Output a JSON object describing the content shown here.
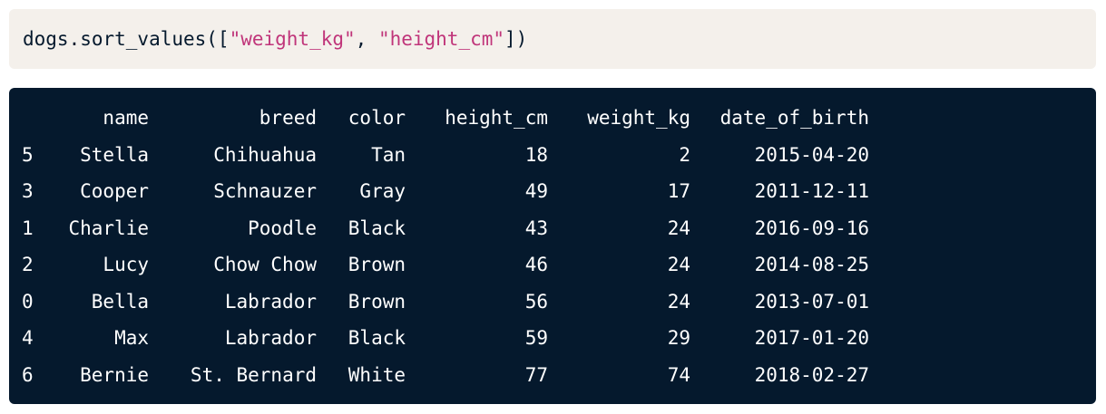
{
  "code": {
    "prefix": "dogs.sort_values([",
    "arg1": "\"weight_kg\"",
    "sep": ", ",
    "arg2": "\"height_cm\"",
    "suffix": "])"
  },
  "table": {
    "columns": [
      "",
      "name",
      "breed",
      "color",
      "height_cm",
      "weight_kg",
      "date_of_birth"
    ],
    "rows": [
      [
        "5",
        "Stella",
        "Chihuahua",
        "Tan",
        "18",
        "2",
        "2015-04-20"
      ],
      [
        "3",
        "Cooper",
        "Schnauzer",
        "Gray",
        "49",
        "17",
        "2011-12-11"
      ],
      [
        "1",
        "Charlie",
        "Poodle",
        "Black",
        "43",
        "24",
        "2016-09-16"
      ],
      [
        "2",
        "Lucy",
        "Chow Chow",
        "Brown",
        "46",
        "24",
        "2014-08-25"
      ],
      [
        "0",
        "Bella",
        "Labrador",
        "Brown",
        "56",
        "24",
        "2013-07-01"
      ],
      [
        "4",
        "Max",
        "Labrador",
        "Black",
        "59",
        "29",
        "2017-01-20"
      ],
      [
        "6",
        "Bernie",
        "St. Bernard",
        "White",
        "77",
        "74",
        "2018-02-27"
      ]
    ]
  },
  "colors": {
    "code_bg": "#f4f0eb",
    "code_text": "#05192d",
    "string_text": "#c0357a",
    "output_bg": "#05192d",
    "output_text": "#ffffff"
  }
}
